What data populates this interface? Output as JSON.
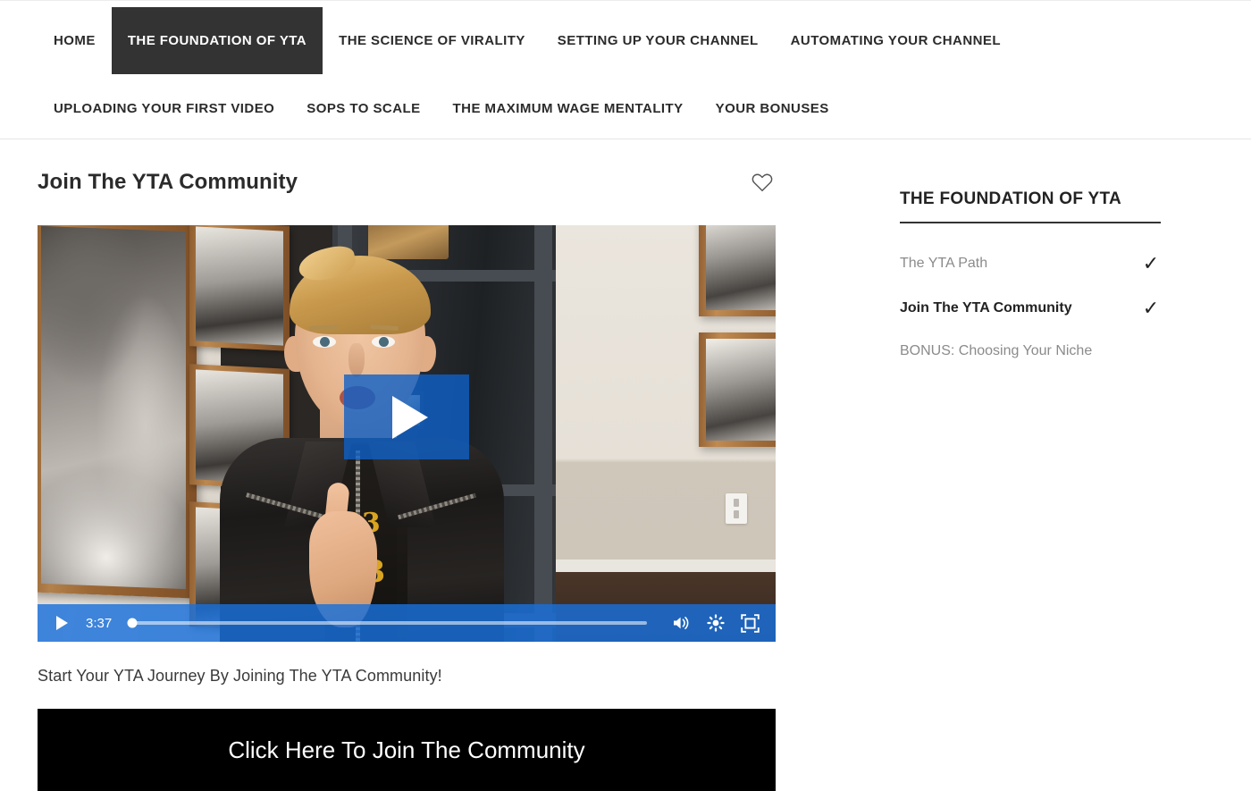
{
  "nav": {
    "row1": [
      {
        "label": "HOME",
        "active": false
      },
      {
        "label": "THE FOUNDATION OF YTA",
        "active": true
      },
      {
        "label": "THE SCIENCE OF VIRALITY",
        "active": false
      },
      {
        "label": "SETTING UP YOUR CHANNEL",
        "active": false
      },
      {
        "label": "AUTOMATING YOUR CHANNEL",
        "active": false
      }
    ],
    "row2": [
      {
        "label": "UPLOADING YOUR FIRST VIDEO",
        "active": false
      },
      {
        "label": "SOPS TO SCALE",
        "active": false
      },
      {
        "label": "THE MAXIMUM WAGE MENTALITY",
        "active": false
      },
      {
        "label": "YOUR BONUSES",
        "active": false
      }
    ]
  },
  "lesson": {
    "title": "Join The YTA Community",
    "favorite_icon": "heart-outline-icon",
    "description": "Start Your YTA Journey By Joining The YTA Community!",
    "cta_label": "Click Here To Join The Community"
  },
  "player": {
    "time": "3:37",
    "progress_percent": 0,
    "play_icon": "play-triangle-icon",
    "volume_icon": "volume-on-icon",
    "settings_icon": "settings-gear-icon",
    "fullscreen_icon": "fullscreen-icon",
    "overlay_play_icon": "big-play-icon",
    "accent_color": "#1870DC"
  },
  "sidebar": {
    "title": "THE FOUNDATION OF YTA",
    "items": [
      {
        "label": "The YTA Path",
        "completed": true,
        "current": false
      },
      {
        "label": "Join The YTA Community",
        "completed": true,
        "current": true
      },
      {
        "label": "BONUS: Choosing Your Niche",
        "completed": false,
        "current": false
      }
    ],
    "check_glyph": "✓"
  }
}
